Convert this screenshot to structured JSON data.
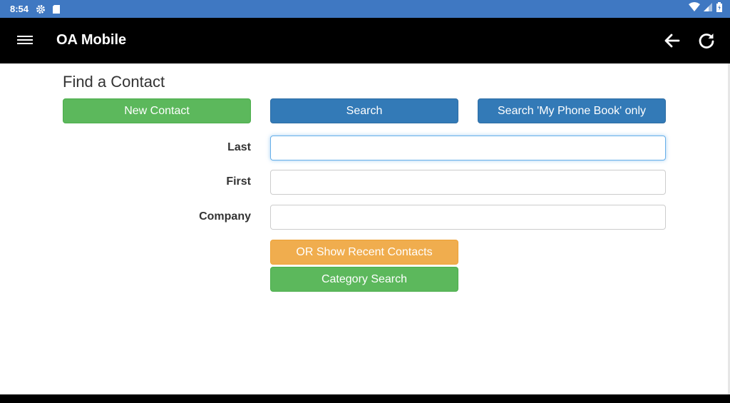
{
  "status_bar": {
    "time": "8:54",
    "left_icons": [
      "gear-icon",
      "sd-card-icon"
    ],
    "right_icons": [
      "wifi-icon",
      "signal-icon",
      "battery-icon"
    ],
    "color": "#3f78c2"
  },
  "app_bar": {
    "title": "OA Mobile",
    "icons": [
      "menu-icon",
      "back-arrow-icon",
      "refresh-icon"
    ]
  },
  "main": {
    "heading": "Find a Contact",
    "buttons": {
      "new_contact": "New Contact",
      "search": "Search",
      "search_phone_book": "Search 'My Phone Book' only",
      "recent_contacts": "OR Show Recent Contacts",
      "category_search": "Category Search"
    },
    "fields": {
      "last": {
        "label": "Last",
        "value": "",
        "placeholder": ""
      },
      "first": {
        "label": "First",
        "value": "",
        "placeholder": ""
      },
      "company": {
        "label": "Company",
        "value": "",
        "placeholder": ""
      }
    }
  },
  "colors": {
    "green": "#5cb85c",
    "blue": "#337ab7",
    "orange": "#f0ad4e"
  }
}
